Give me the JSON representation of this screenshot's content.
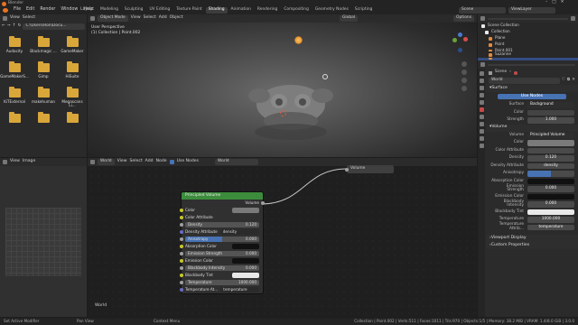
{
  "window_title": "Blender",
  "menu": [
    "File",
    "Edit",
    "Render",
    "Window",
    "Help"
  ],
  "workspaces": [
    "Layout",
    "Modeling",
    "Sculpting",
    "UV Editing",
    "Texture Paint",
    "Shading",
    "Animation",
    "Rendering",
    "Compositing",
    "Geometry Nodes",
    "Scripting"
  ],
  "active_workspace": "Shading",
  "scene_label": "Scene",
  "view_layer_label": "ViewLayer",
  "file_browser": {
    "view_menu": [
      "View",
      "Select"
    ],
    "path": "C:\\Users\\Ron\\Docu...",
    "items": [
      "Audacity",
      "Blackmagic ...",
      "GameMaker",
      "GameMakerS...",
      "Gimp",
      "HiSuite",
      "KiTExternal",
      "makehuman",
      "Megascans Li...",
      "",
      "",
      ""
    ]
  },
  "viewport": {
    "mode": "Object Mode",
    "menus": [
      "View",
      "Select",
      "Add",
      "Object"
    ],
    "orientation": "Global",
    "overlay_title": "User Perspective",
    "overlay_sub": "(1) Collection | Point.002",
    "options": "Options"
  },
  "outliner": {
    "title": "Scene Collection",
    "rows": [
      "Collection",
      "Plane",
      "Point",
      "Point.001",
      "Point.002",
      "Suzanne"
    ]
  },
  "properties": {
    "world_name": "World",
    "scene": "Scene",
    "surface_header": "Surface",
    "use_nodes": "Use Nodes",
    "surface_label": "Surface",
    "surface_value": "Background",
    "color_label": "Color",
    "strength_label": "Strength",
    "strength_value": "1.000",
    "volume_header": "Volume",
    "volume_label": "Volume",
    "volume_value": "Principled Volume",
    "rows": [
      {
        "label": "Color",
        "value": ""
      },
      {
        "label": "Color Attribute",
        "value": ""
      },
      {
        "label": "Density",
        "value": "0.120"
      },
      {
        "label": "Density Attribute",
        "value": "density"
      },
      {
        "label": "Anisotropy",
        "value": ""
      },
      {
        "label": "Absorption Color",
        "value": ""
      },
      {
        "label": "Emission Strength",
        "value": "0.000"
      },
      {
        "label": "Emission Color",
        "value": ""
      },
      {
        "label": "Blackbody Intensity",
        "value": "0.000"
      },
      {
        "label": "Blackbody Tint",
        "value": ""
      },
      {
        "label": "Temperature",
        "value": "1000.000"
      },
      {
        "label": "Temperature Attrib...",
        "value": "temperature"
      }
    ],
    "viewport_display": "Viewport Display",
    "custom_properties": "Custom Properties"
  },
  "node_editor": {
    "world_label": "World",
    "world_name": "World",
    "menus": [
      "View",
      "Select",
      "Add",
      "Node"
    ],
    "use_nodes": "Use Nodes",
    "bottom_label": "World",
    "output_node": "Volume",
    "principled": {
      "title": "Principled Volume",
      "output": "Volume",
      "rows": [
        {
          "label": "Color",
          "value": "",
          "kind": "color"
        },
        {
          "label": "Color Attribute",
          "value": "",
          "kind": "plain"
        },
        {
          "label": "Density",
          "value": "0.120",
          "kind": "slider"
        },
        {
          "label": "Density Attribute",
          "value": "density",
          "kind": "field"
        },
        {
          "label": "Anisotropy",
          "value": "0.000",
          "kind": "slider"
        },
        {
          "label": "Absorption Color",
          "value": "",
          "kind": "color"
        },
        {
          "label": "Emission Strength",
          "value": "0.000",
          "kind": "slider"
        },
        {
          "label": "Emission Color",
          "value": "",
          "kind": "color"
        },
        {
          "label": "Blackbody Intensity",
          "value": "0.000",
          "kind": "slider"
        },
        {
          "label": "Blackbody Tint",
          "value": "",
          "kind": "color"
        },
        {
          "label": "Temperature",
          "value": "1000.000",
          "kind": "slider"
        },
        {
          "label": "Temperature At...",
          "value": "temperature",
          "kind": "field"
        }
      ]
    }
  },
  "image_editor": {
    "view_menu": [
      "View",
      "Image"
    ]
  },
  "status": {
    "left1": "Set Active Modifier",
    "left2": "Pan View",
    "left3": "Context Menu",
    "right": "Collection | Point.002 | Verts:511 | Faces:1011 | Tris:970 | Objects:1/5 | Memory: 38.2 MiB | VRAM: 1.4/8.0 GiB | 3.0.0"
  },
  "colors": {
    "accent": "#4772b3",
    "node_header": "#3c8c3c",
    "light": "#f2a24a",
    "socket_yellow": "#c7c729"
  }
}
